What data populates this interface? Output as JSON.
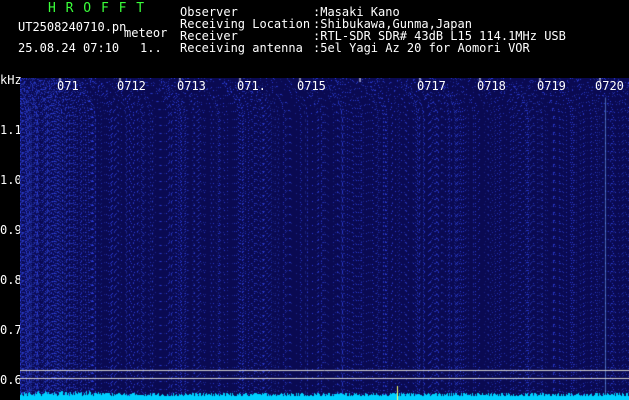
{
  "app": {
    "name": "H R O F F T"
  },
  "file": {
    "name": "UT2508240710.pn",
    "timestamp": "25.08.24 07:10",
    "tag": "meteor",
    "count": "1.."
  },
  "info_labels": [
    "Observer",
    "Receiving Location",
    "Receiver",
    "Receiving antenna"
  ],
  "info_values": [
    ":Masaki Kano",
    ":Shibukawa,Gunma,Japan",
    ":RTL-SDR SDR# 43dB L15 114.1MHz USB",
    ":5el Yagi Az 20 for Aomori VOR"
  ],
  "plot": {
    "y_unit": "kHz",
    "y_ticks": [
      "1.1",
      "1.0",
      "0.9",
      "0.8",
      "0.7",
      "0.6"
    ],
    "x_ticks": [
      "071",
      "0712",
      "0713",
      "071.",
      "0715",
      "0717",
      "0718",
      "0719",
      "0720"
    ],
    "colors": {
      "background": "#0a0a52",
      "noise": "#2b3bd6",
      "spectrum": "#00d0ff",
      "lines": "#cfcfcf"
    }
  }
}
